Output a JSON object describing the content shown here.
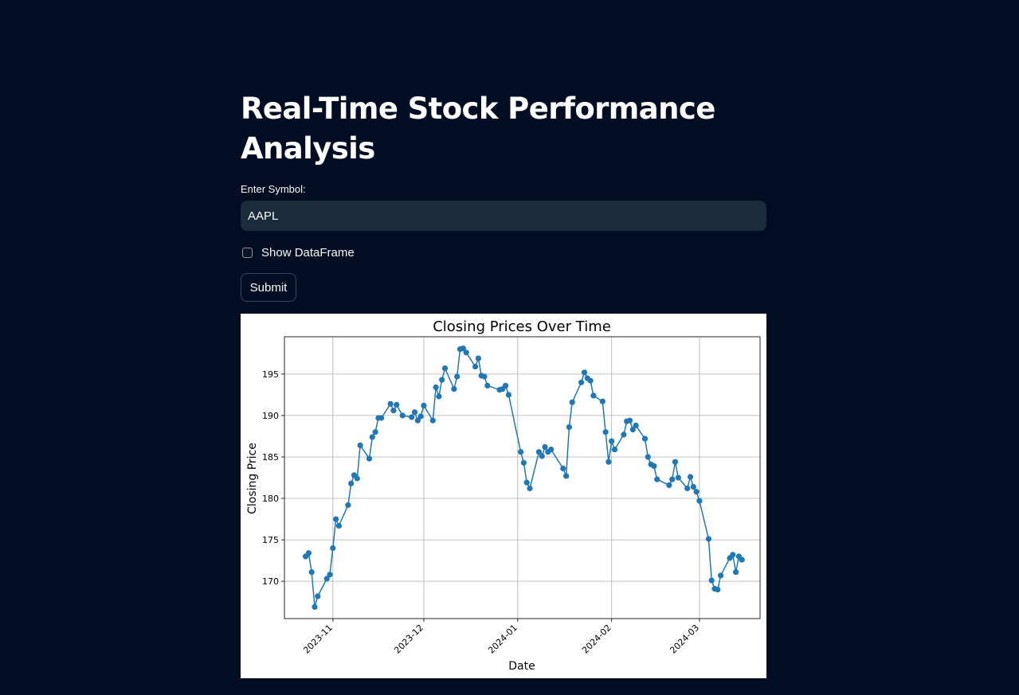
{
  "page": {
    "title": "Real-Time Stock Performance Analysis"
  },
  "symbol_input": {
    "label": "Enter Symbol:",
    "value": "AAPL"
  },
  "show_dataframe": {
    "label": "Show DataFrame",
    "checked": false
  },
  "submit": {
    "label": "Submit"
  },
  "colors": {
    "background": "#000d22",
    "input_bg": "#1a2b3b",
    "line": "#1f77b4"
  },
  "chart_data": {
    "type": "line",
    "title": "Closing Prices Over Time",
    "xlabel": "Date",
    "ylabel": "Closing Price",
    "xlim": [
      "2023-10-16",
      "2024-03-21"
    ],
    "ylim": [
      165.5,
      199.5
    ],
    "grid": true,
    "markers": true,
    "xticks": [
      "2023-11",
      "2023-12",
      "2024-01",
      "2024-02",
      "2024-03"
    ],
    "yticks": [
      170,
      175,
      180,
      185,
      190,
      195
    ],
    "series": [
      {
        "points": [
          [
            "2023-10-23",
            173.0
          ],
          [
            "2023-10-24",
            173.4
          ],
          [
            "2023-10-25",
            171.1
          ],
          [
            "2023-10-26",
            166.9
          ],
          [
            "2023-10-27",
            168.2
          ],
          [
            "2023-10-30",
            170.3
          ],
          [
            "2023-10-31",
            170.8
          ],
          [
            "2023-11-01",
            174.0
          ],
          [
            "2023-11-02",
            177.5
          ],
          [
            "2023-11-03",
            176.7
          ],
          [
            "2023-11-06",
            179.2
          ],
          [
            "2023-11-07",
            181.8
          ],
          [
            "2023-11-08",
            182.8
          ],
          [
            "2023-11-09",
            182.4
          ],
          [
            "2023-11-10",
            186.4
          ],
          [
            "2023-11-13",
            184.8
          ],
          [
            "2023-11-14",
            187.4
          ],
          [
            "2023-11-15",
            188.0
          ],
          [
            "2023-11-16",
            189.7
          ],
          [
            "2023-11-17",
            189.7
          ],
          [
            "2023-11-20",
            191.4
          ],
          [
            "2023-11-21",
            190.6
          ],
          [
            "2023-11-22",
            191.3
          ],
          [
            "2023-11-24",
            190.0
          ],
          [
            "2023-11-27",
            189.8
          ],
          [
            "2023-11-28",
            190.4
          ],
          [
            "2023-11-29",
            189.4
          ],
          [
            "2023-11-30",
            189.9
          ],
          [
            "2023-12-01",
            191.2
          ],
          [
            "2023-12-04",
            189.4
          ],
          [
            "2023-12-05",
            193.4
          ],
          [
            "2023-12-06",
            192.3
          ],
          [
            "2023-12-07",
            194.3
          ],
          [
            "2023-12-08",
            195.7
          ],
          [
            "2023-12-11",
            193.2
          ],
          [
            "2023-12-12",
            194.7
          ],
          [
            "2023-12-13",
            198.0
          ],
          [
            "2023-12-14",
            198.1
          ],
          [
            "2023-12-15",
            197.6
          ],
          [
            "2023-12-18",
            195.9
          ],
          [
            "2023-12-19",
            196.9
          ],
          [
            "2023-12-20",
            194.8
          ],
          [
            "2023-12-21",
            194.7
          ],
          [
            "2023-12-22",
            193.6
          ],
          [
            "2023-12-26",
            193.1
          ],
          [
            "2023-12-27",
            193.2
          ],
          [
            "2023-12-28",
            193.6
          ],
          [
            "2023-12-29",
            192.5
          ],
          [
            "2024-01-02",
            185.6
          ],
          [
            "2024-01-03",
            184.3
          ],
          [
            "2024-01-04",
            181.9
          ],
          [
            "2024-01-05",
            181.2
          ],
          [
            "2024-01-08",
            185.6
          ],
          [
            "2024-01-09",
            185.1
          ],
          [
            "2024-01-10",
            186.2
          ],
          [
            "2024-01-11",
            185.6
          ],
          [
            "2024-01-12",
            185.9
          ],
          [
            "2024-01-16",
            183.6
          ],
          [
            "2024-01-17",
            182.7
          ],
          [
            "2024-01-18",
            188.6
          ],
          [
            "2024-01-19",
            191.6
          ],
          [
            "2024-01-22",
            194.0
          ],
          [
            "2024-01-23",
            195.2
          ],
          [
            "2024-01-24",
            194.5
          ],
          [
            "2024-01-25",
            194.2
          ],
          [
            "2024-01-26",
            192.4
          ],
          [
            "2024-01-29",
            191.7
          ],
          [
            "2024-01-30",
            188.0
          ],
          [
            "2024-01-31",
            184.4
          ],
          [
            "2024-02-01",
            186.9
          ],
          [
            "2024-02-02",
            185.9
          ],
          [
            "2024-02-05",
            187.7
          ],
          [
            "2024-02-06",
            189.3
          ],
          [
            "2024-02-07",
            189.4
          ],
          [
            "2024-02-08",
            188.3
          ],
          [
            "2024-02-09",
            188.8
          ],
          [
            "2024-02-12",
            187.2
          ],
          [
            "2024-02-13",
            185.0
          ],
          [
            "2024-02-14",
            184.1
          ],
          [
            "2024-02-15",
            183.9
          ],
          [
            "2024-02-16",
            182.3
          ],
          [
            "2024-02-20",
            181.6
          ],
          [
            "2024-02-21",
            182.3
          ],
          [
            "2024-02-22",
            184.4
          ],
          [
            "2024-02-23",
            182.5
          ],
          [
            "2024-02-26",
            181.2
          ],
          [
            "2024-02-27",
            182.6
          ],
          [
            "2024-02-28",
            181.4
          ],
          [
            "2024-02-29",
            180.8
          ],
          [
            "2024-03-01",
            179.7
          ],
          [
            "2024-03-04",
            175.1
          ],
          [
            "2024-03-05",
            170.1
          ],
          [
            "2024-03-06",
            169.1
          ],
          [
            "2024-03-07",
            169.0
          ],
          [
            "2024-03-08",
            170.7
          ],
          [
            "2024-03-11",
            172.8
          ],
          [
            "2024-03-12",
            173.2
          ],
          [
            "2024-03-13",
            171.1
          ],
          [
            "2024-03-14",
            173.0
          ],
          [
            "2024-03-15",
            172.6
          ]
        ]
      }
    ]
  }
}
